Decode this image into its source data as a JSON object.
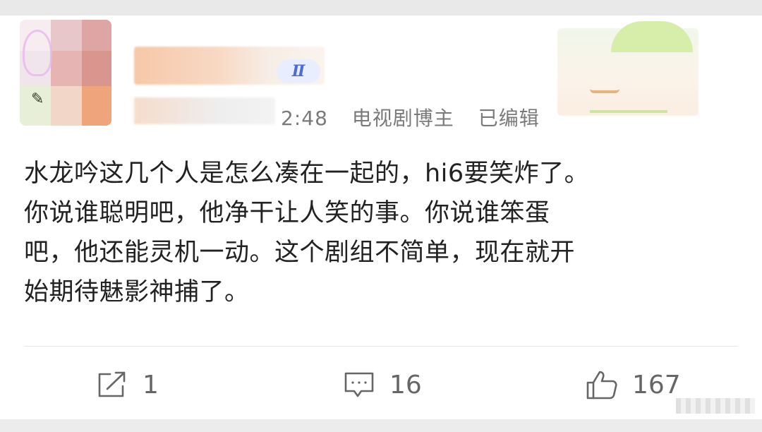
{
  "post": {
    "meta": {
      "time": "2:48",
      "source": "电视剧博主",
      "edited": "已编辑"
    },
    "badge": "Ⅱ",
    "content_lines": [
      "水龙吟这几个人是怎么凑在一起的，hi6要笑炸了。",
      "你说谁聪明吧，他净干让人笑的事。你说谁笨蛋",
      "吧，他还能灵机一动。这个剧组不简单，现在就开",
      "始期待魅影神捕了。"
    ]
  },
  "actions": {
    "share": {
      "icon": "share-icon",
      "count": "1"
    },
    "comment": {
      "icon": "comment-icon",
      "count": "16"
    },
    "like": {
      "icon": "thumbs-up-icon",
      "count": "167"
    }
  },
  "colors": {
    "text": "#222222",
    "meta": "#7a7a7a",
    "action": "#666666",
    "badge": "#4f69d6"
  }
}
